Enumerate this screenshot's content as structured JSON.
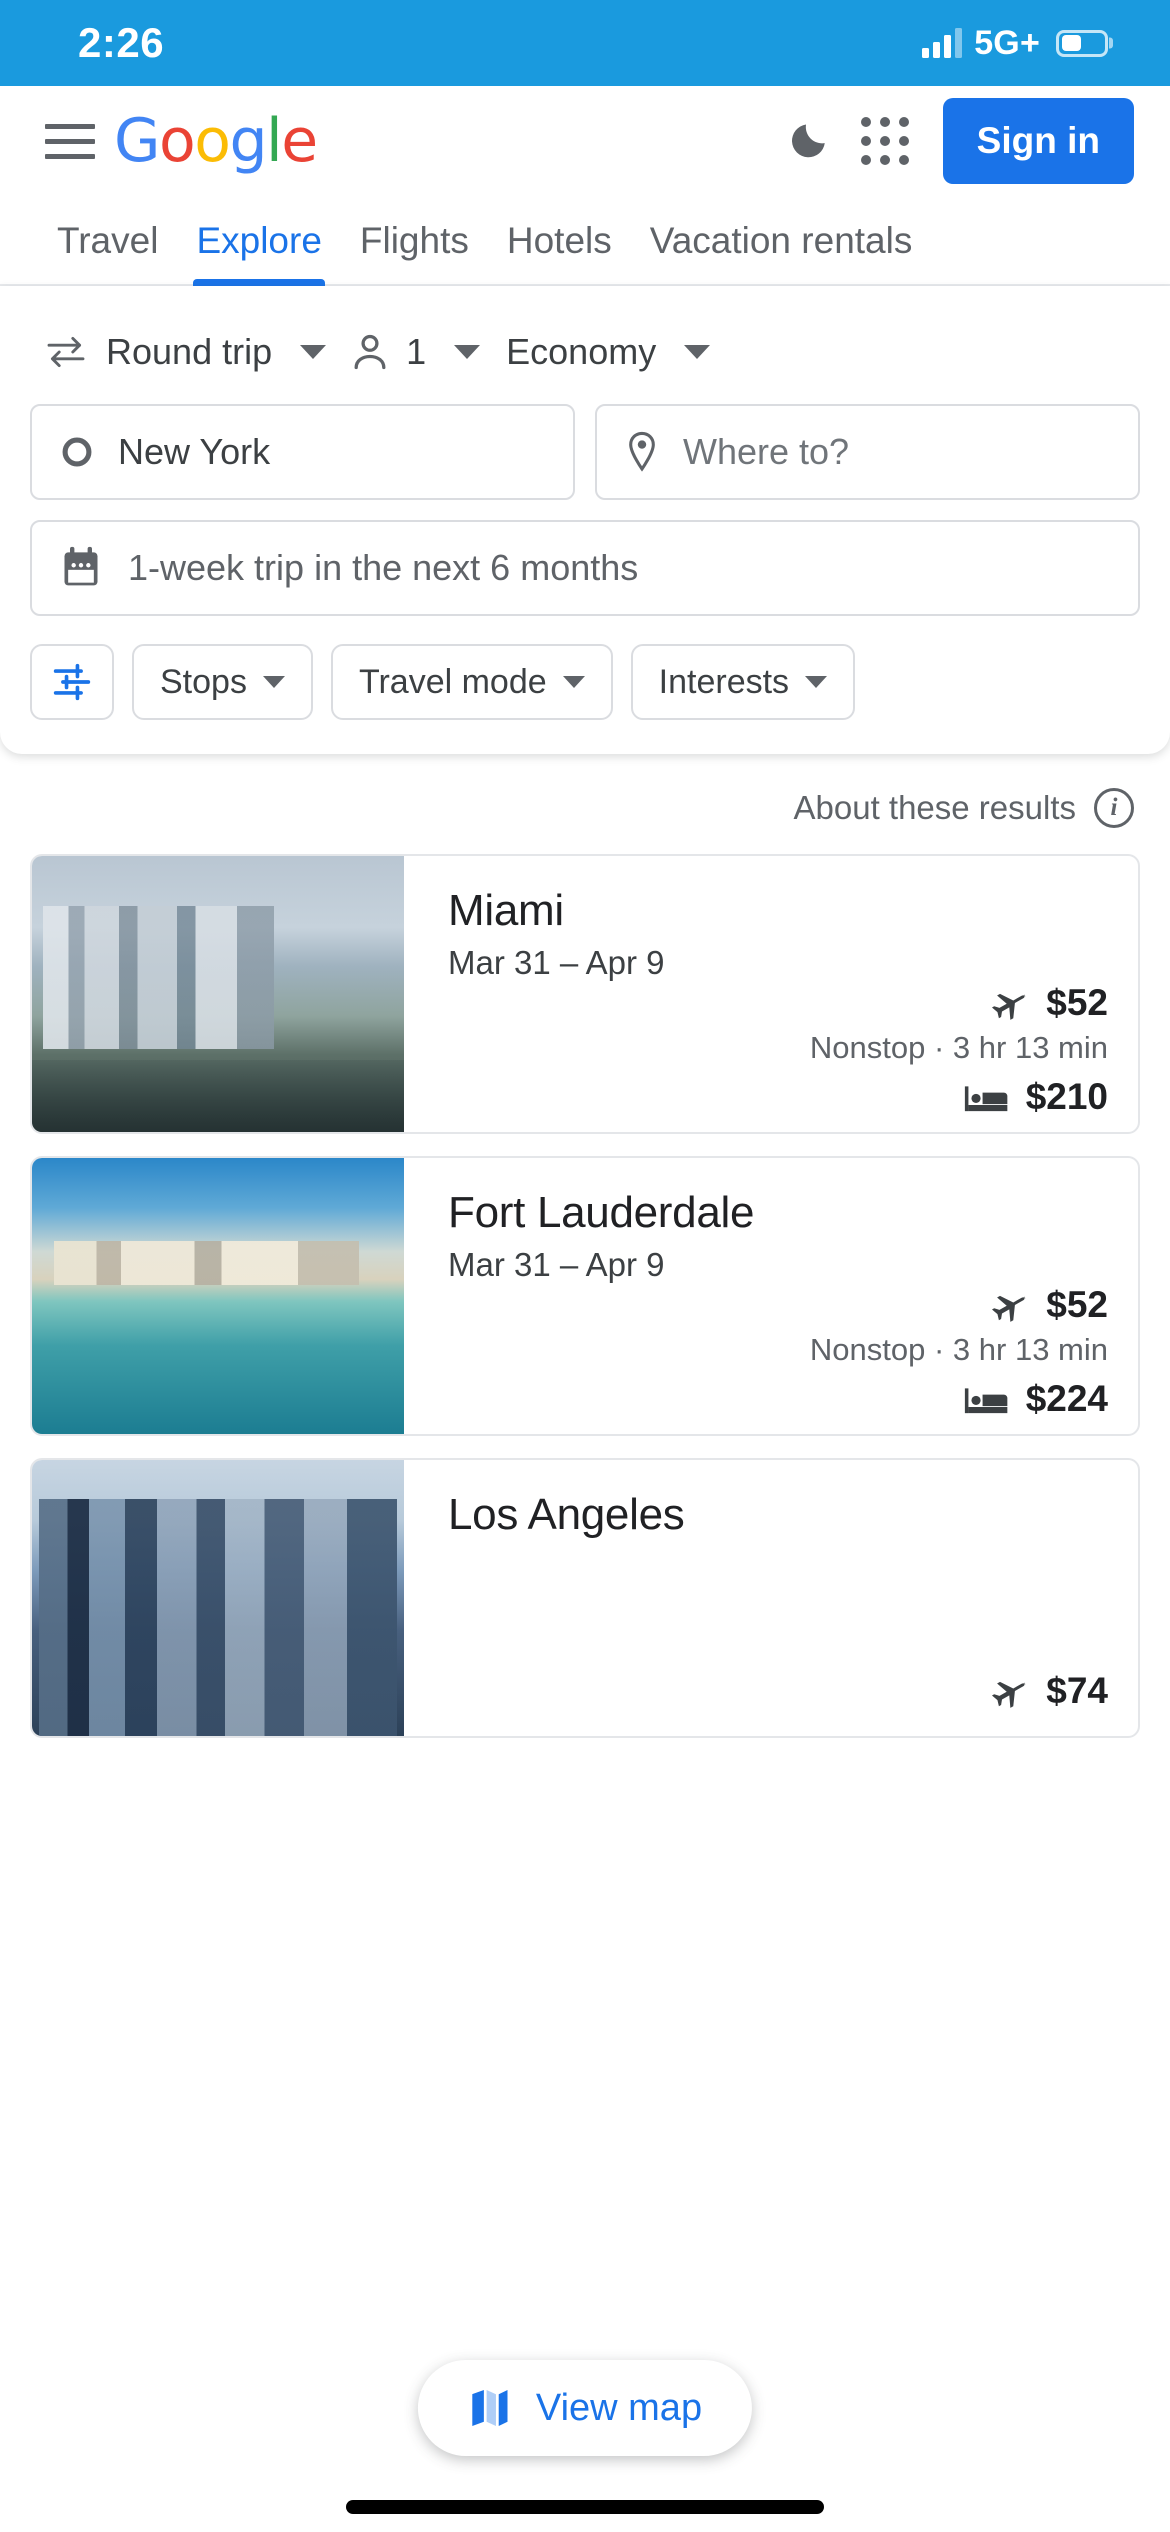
{
  "status_bar": {
    "time": "2:26",
    "network": "5G+",
    "signal_icon": "signal-bars-icon",
    "battery_icon": "battery-icon"
  },
  "header": {
    "menu_icon": "hamburger-menu-icon",
    "logo": [
      "G",
      "o",
      "o",
      "g",
      "l",
      "e"
    ],
    "dark_mode_icon": "moon-icon",
    "apps_icon": "apps-grid-icon",
    "sign_in_label": "Sign in",
    "accent_color": "#1a73e8"
  },
  "tabs": [
    {
      "label": "Travel",
      "active": false
    },
    {
      "label": "Explore",
      "active": true
    },
    {
      "label": "Flights",
      "active": false
    },
    {
      "label": "Hotels",
      "active": false
    },
    {
      "label": "Vacation rentals",
      "active": false
    }
  ],
  "search": {
    "trip_type": {
      "label": "Round trip",
      "icon": "swap-arrows-icon"
    },
    "passengers": {
      "label": "1",
      "icon": "person-icon"
    },
    "cabin_class": {
      "label": "Economy"
    },
    "origin": {
      "value": "New York",
      "icon": "origin-circle-icon"
    },
    "destination": {
      "placeholder": "Where to?",
      "icon": "map-pin-icon"
    },
    "dates": {
      "value": "1-week trip in the next 6 months",
      "icon": "calendar-icon"
    },
    "filters": {
      "tune_icon": "filter-sliders-icon",
      "chips": [
        "Stops",
        "Travel mode",
        "Interests"
      ]
    }
  },
  "results": {
    "about_label": "About these results",
    "about_icon": "info-icon",
    "flight_icon": "airplane-icon",
    "hotel_icon": "bed-icon",
    "cards": [
      {
        "city": "Miami",
        "dates": "Mar 31 – Apr 9",
        "flight_price": "$52",
        "flight_detail": "Nonstop · 3 hr 13 min",
        "hotel_price": "$210",
        "image": "miami-skyline-photo"
      },
      {
        "city": "Fort Lauderdale",
        "dates": "Mar 31 – Apr 9",
        "flight_price": "$52",
        "flight_detail": "Nonstop · 3 hr 13 min",
        "hotel_price": "$224",
        "image": "fort-lauderdale-beach-photo"
      },
      {
        "city": "Los Angeles",
        "dates": "",
        "flight_price": "$74",
        "flight_detail": "",
        "hotel_price": "",
        "image": "los-angeles-skyline-photo"
      }
    ]
  },
  "view_map": {
    "label": "View map",
    "icon": "map-icon"
  }
}
